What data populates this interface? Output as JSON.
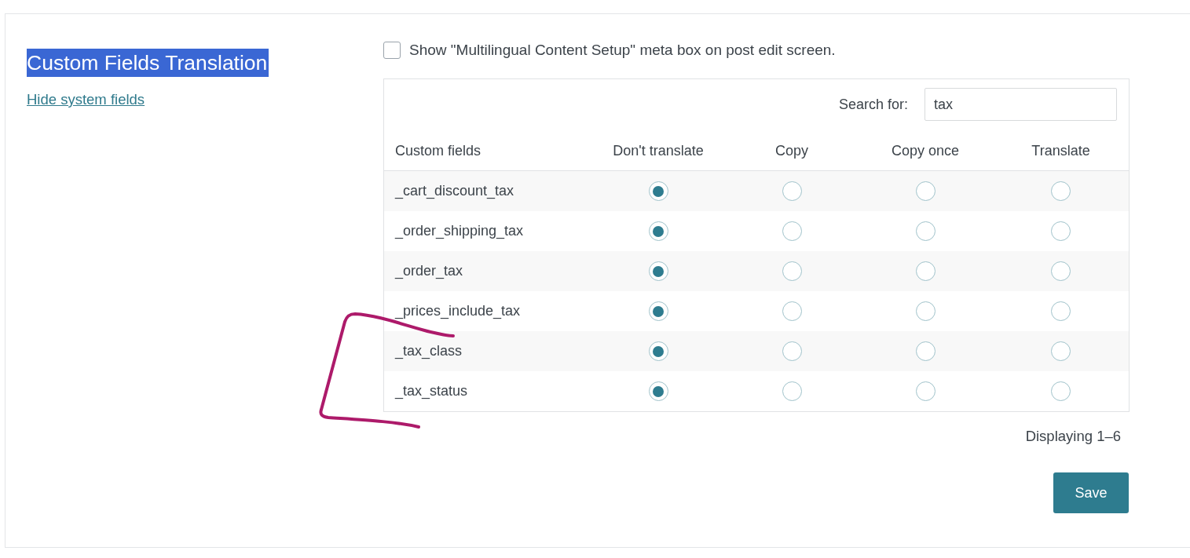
{
  "settings_panel": {
    "title": {
      "text": "Custom Fields Translation",
      "highlighted": true
    },
    "link": "Hide system fields"
  },
  "meta_box_option": {
    "label": "Show \"Multilingual Content Setup\" meta box on post edit screen.",
    "checked": false
  },
  "search": {
    "label": "Search for:",
    "value": "tax"
  },
  "table": {
    "columns": [
      "Custom fields",
      "Don't translate",
      "Copy",
      "Copy once",
      "Translate"
    ],
    "rows": [
      {
        "field": "_cart_discount_tax",
        "options": [
          {
            "selected": true
          },
          {
            "selected": false
          },
          {
            "selected": false
          },
          {
            "selected": false
          }
        ]
      },
      {
        "field": "_order_shipping_tax",
        "options": [
          {
            "selected": true
          },
          {
            "selected": false
          },
          {
            "selected": false
          },
          {
            "selected": false
          }
        ]
      },
      {
        "field": "_order_tax",
        "options": [
          {
            "selected": true
          },
          {
            "selected": false
          },
          {
            "selected": false
          },
          {
            "selected": false
          }
        ]
      },
      {
        "field": "_prices_include_tax",
        "options": [
          {
            "selected": true
          },
          {
            "selected": false
          },
          {
            "selected": false
          },
          {
            "selected": false
          }
        ]
      },
      {
        "field": "_tax_class",
        "options": [
          {
            "selected": true
          },
          {
            "selected": false
          },
          {
            "selected": false
          },
          {
            "selected": false
          }
        ]
      },
      {
        "field": "_tax_status",
        "options": [
          {
            "selected": true
          },
          {
            "selected": false
          },
          {
            "selected": false
          },
          {
            "selected": false
          }
        ]
      }
    ]
  },
  "pagination": "Displaying 1–6",
  "buttons": [
    "Save"
  ]
}
